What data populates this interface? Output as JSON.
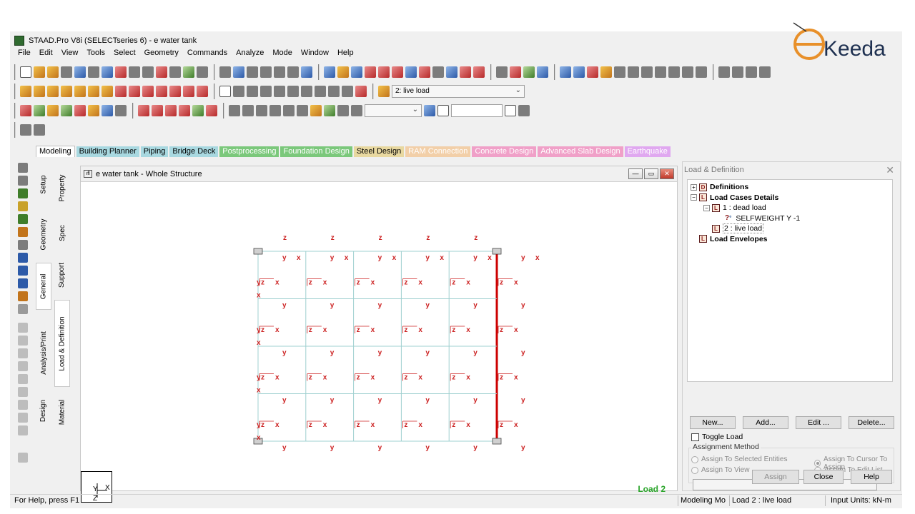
{
  "window": {
    "title": "STAAD.Pro V8i (SELECTseries 6) - e water tank"
  },
  "menu": [
    "File",
    "Edit",
    "View",
    "Tools",
    "Select",
    "Geometry",
    "Commands",
    "Analyze",
    "Mode",
    "Window",
    "Help"
  ],
  "toolbar": {
    "load_combo": "2: live load",
    "blank_combo": ""
  },
  "tabs": [
    {
      "label": "Modeling",
      "color": "#ffffff",
      "text": "#000000"
    },
    {
      "label": "Building Planner",
      "color": "#a8d8e0",
      "text": "#000000"
    },
    {
      "label": "Piping",
      "color": "#a8d8e0",
      "text": "#000000"
    },
    {
      "label": "Bridge Deck",
      "color": "#a8d8e0",
      "text": "#000000"
    },
    {
      "label": "Postprocessing",
      "color": "#7bc87b",
      "text": "#ffffff"
    },
    {
      "label": "Foundation Design",
      "color": "#7bc87b",
      "text": "#ffffff"
    },
    {
      "label": "Steel Design",
      "color": "#e8d8a0",
      "text": "#000000"
    },
    {
      "label": "RAM Connection",
      "color": "#f2cfa8",
      "text": "#ffffff"
    },
    {
      "label": "Concrete Design",
      "color": "#f0a0c8",
      "text": "#ffffff"
    },
    {
      "label": "Advanced Slab Design",
      "color": "#f0a0c8",
      "text": "#ffffff"
    },
    {
      "label": "Earthquake",
      "color": "#e0a8f0",
      "text": "#ffffff"
    }
  ],
  "sidetabs_outer": [
    "Setup",
    "Geometry",
    "General",
    "Analysis/Print",
    "Design"
  ],
  "sidetabs_inner": [
    "Property",
    "Spec",
    "Support",
    "Load & Definition",
    "Material"
  ],
  "viewport": {
    "title": "e water tank - Whole Structure",
    "load_label": "Load 2"
  },
  "panel": {
    "title": "Load & Definition",
    "tree": {
      "definitions": "Definitions",
      "load_cases": "Load Cases Details",
      "case1": "1 : dead load",
      "selfweight": "SELFWEIGHT Y -1",
      "case2": "2 : live load",
      "envelopes": "Load Envelopes"
    },
    "buttons": {
      "new": "New...",
      "add": "Add...",
      "edit": "Edit ...",
      "delete": "Delete..."
    },
    "toggle_load": "Toggle Load",
    "assignment_method": "Assignment Method",
    "radios": {
      "selected": "Assign To Selected Entities",
      "view": "Assign To View",
      "cursor": "Assign To Cursor To Assign",
      "editlist": "Assign To Edit List"
    },
    "footer": {
      "assign": "Assign",
      "close": "Close",
      "help": "Help"
    }
  },
  "status": {
    "help": "For Help, press F1",
    "mode": "Modeling Mo",
    "load": "Load 2 : live load",
    "units": "Input Units:  kN-m"
  },
  "logo": {
    "text": "Keeda"
  },
  "colors": {
    "member": "#9fd0d0",
    "label": "#cc2222",
    "selected_member": "#cc0000",
    "load_text": "#2aa52a"
  }
}
